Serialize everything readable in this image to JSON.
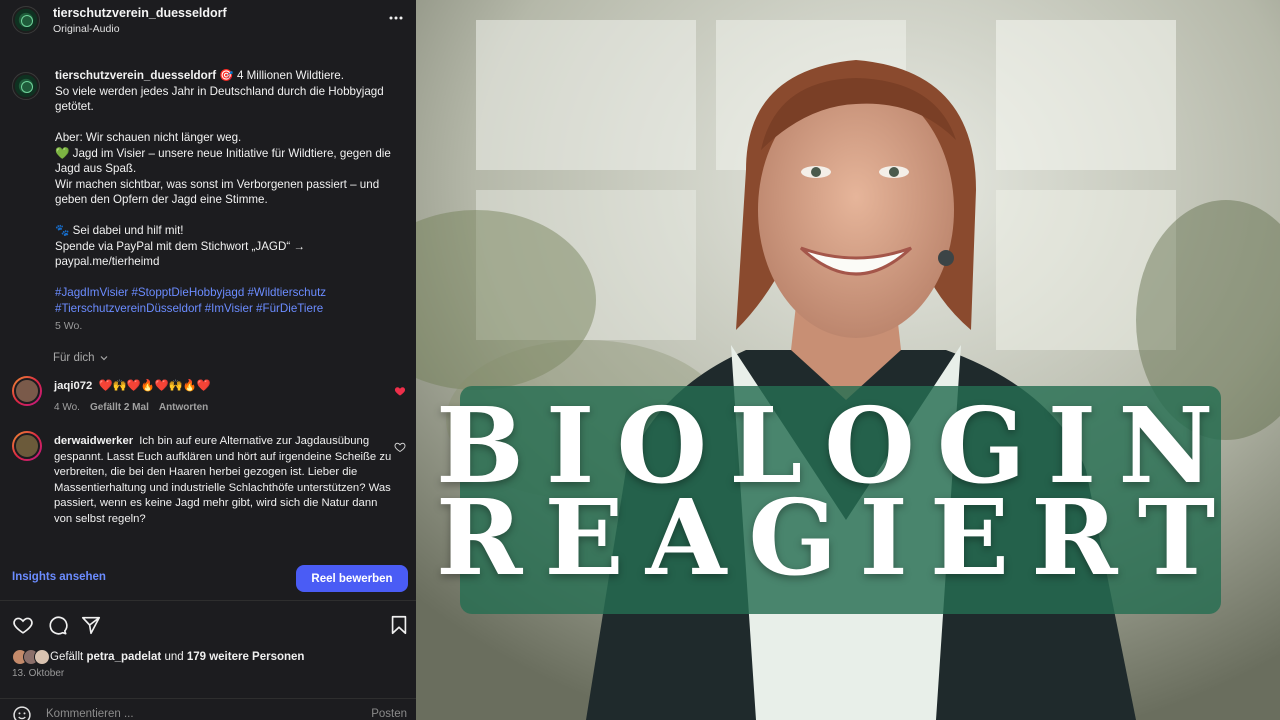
{
  "header": {
    "username": "tierschutzverein_duesseldorf",
    "subtitle": "Original-Audio",
    "more_icon": "more-horizontal-icon"
  },
  "caption": {
    "username": "tierschutzverein_duesseldorf",
    "lines": [
      "🎯 4 Millionen Wildtiere.",
      "So viele werden jedes Jahr in Deutschland durch die Hobbyjagd getötet.",
      "",
      "Aber: Wir schauen nicht länger weg.",
      "💚 Jagd im Visier – unsere neue Initiative für Wildtiere, gegen die Jagd aus Spaß.",
      "Wir machen sichtbar, was sonst im Verborgenen passiert – und geben den Opfern der Jagd eine Stimme.",
      "",
      "🐾 Sei dabei und hilf mit!",
      "Spende via PayPal mit dem Stichwort „JAGD“ → paypal.me/tierheimd",
      ""
    ],
    "hashtags": "#JagdImVisier #StopptDieHobbyjagd #Wildtierschutz #TierschutzvereinDüsseldorf #ImVisier #FürDieTiere",
    "time": "5 Wo."
  },
  "sort_label": "Für dich",
  "comments": [
    {
      "username": "jaqi072",
      "text": "❤️🙌❤️🔥❤️🙌🔥❤️",
      "time": "4 Wo.",
      "likes": "Gefällt 2 Mal",
      "reply": "Antworten",
      "liked": true
    },
    {
      "username": "derwaidwerker",
      "text": "Ich bin auf eure Alternative zur Jagdausübung gespannt. Lasst Euch aufklären und hört auf irgendeine Scheiße zu verbreiten, die bei den Haaren herbei gezogen ist. Lieber die Massentierhaltung und industrielle Schlachthöfe unterstützen? Was passiert, wenn es keine Jagd mehr gibt, wird sich die Natur dann von selbst regeln?",
      "liked": false
    }
  ],
  "actions": {
    "insights": "Insights ansehen",
    "boost": "Reel bewerben"
  },
  "icons": [
    "heart-icon",
    "comment-icon",
    "share-icon",
    "bookmark-icon",
    "emoji-icon"
  ],
  "likes": {
    "prefix": "Gefällt",
    "user": "petra_padelat",
    "middle": "und",
    "others": "179 weitere Personen"
  },
  "date": "13. Oktober",
  "comment_box": {
    "placeholder": "Kommentieren ...",
    "post": "Posten"
  },
  "video": {
    "title_line_1": "BIOLOGIN",
    "title_line_2": "REAGIERT",
    "banner_color": "#266e52"
  }
}
